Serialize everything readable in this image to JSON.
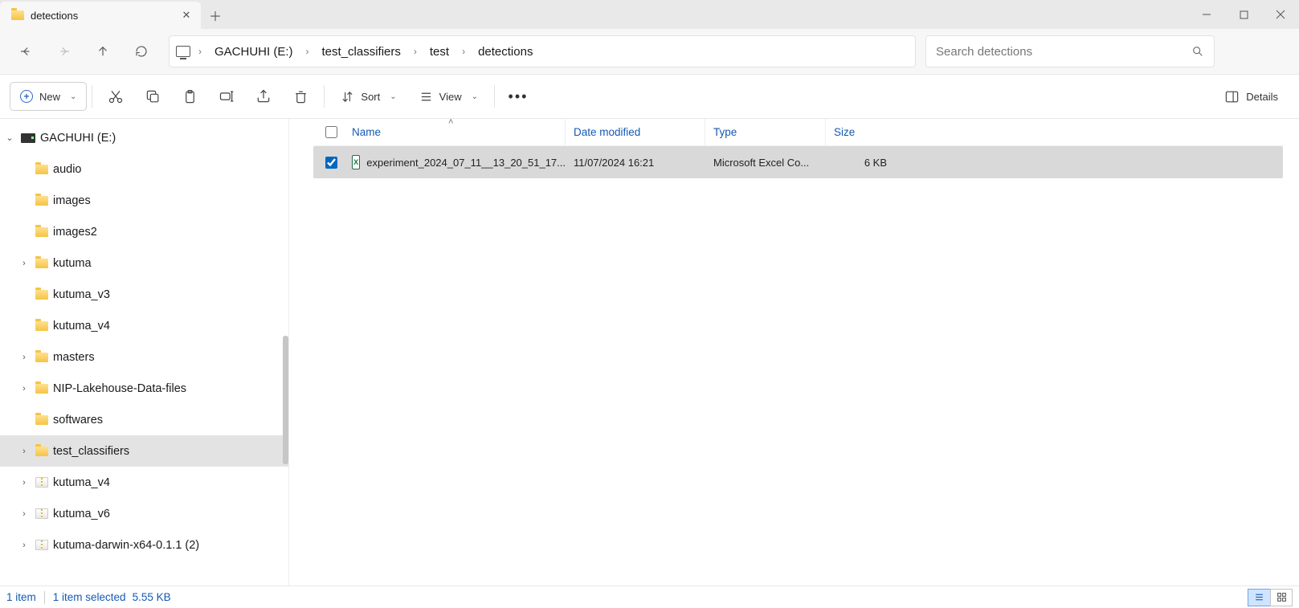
{
  "tab": {
    "title": "detections"
  },
  "breadcrumb": [
    "GACHUHI (E:)",
    "test_classifiers",
    "test",
    "detections"
  ],
  "search": {
    "placeholder": "Search detections"
  },
  "toolbar": {
    "new": "New",
    "sort": "Sort",
    "view": "View",
    "details": "Details"
  },
  "tree": {
    "root": "GACHUHI (E:)",
    "items": [
      {
        "chev": "blank",
        "icon": "folder",
        "label": "audio"
      },
      {
        "chev": "blank",
        "icon": "folder",
        "label": "images"
      },
      {
        "chev": "blank",
        "icon": "folder",
        "label": "images2"
      },
      {
        "chev": ">",
        "icon": "folder",
        "label": "kutuma"
      },
      {
        "chev": "blank",
        "icon": "folder",
        "label": "kutuma_v3"
      },
      {
        "chev": "blank",
        "icon": "folder",
        "label": "kutuma_v4"
      },
      {
        "chev": ">",
        "icon": "folder",
        "label": "masters"
      },
      {
        "chev": ">",
        "icon": "folder",
        "label": "NIP-Lakehouse-Data-files"
      },
      {
        "chev": "blank",
        "icon": "folder",
        "label": "softwares"
      },
      {
        "chev": ">",
        "icon": "folder",
        "label": "test_classifiers",
        "selected": true
      },
      {
        "chev": ">",
        "icon": "zip",
        "label": "kutuma_v4"
      },
      {
        "chev": ">",
        "icon": "zip",
        "label": "kutuma_v6"
      },
      {
        "chev": ">",
        "icon": "zip",
        "label": "kutuma-darwin-x64-0.1.1 (2)"
      }
    ]
  },
  "columns": {
    "name": "Name",
    "date": "Date modified",
    "type": "Type",
    "size": "Size"
  },
  "rows": [
    {
      "checked": true,
      "name": "experiment_2024_07_11__13_20_51_17...",
      "date": "11/07/2024 16:21",
      "type": "Microsoft Excel Co...",
      "size": "6 KB"
    }
  ],
  "status": {
    "count": "1 item",
    "selected": "1 item selected",
    "size": "5.55 KB"
  }
}
